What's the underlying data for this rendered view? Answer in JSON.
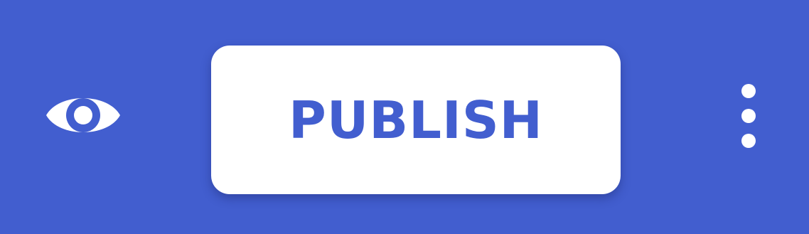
{
  "toolbar": {
    "preview_icon": "eye-icon",
    "publish_label": "PUBLISH",
    "more_icon": "more-vertical-icon"
  },
  "colors": {
    "background": "#425ecf",
    "button_bg": "#ffffff",
    "accent": "#425ecf",
    "icon": "#ffffff"
  }
}
